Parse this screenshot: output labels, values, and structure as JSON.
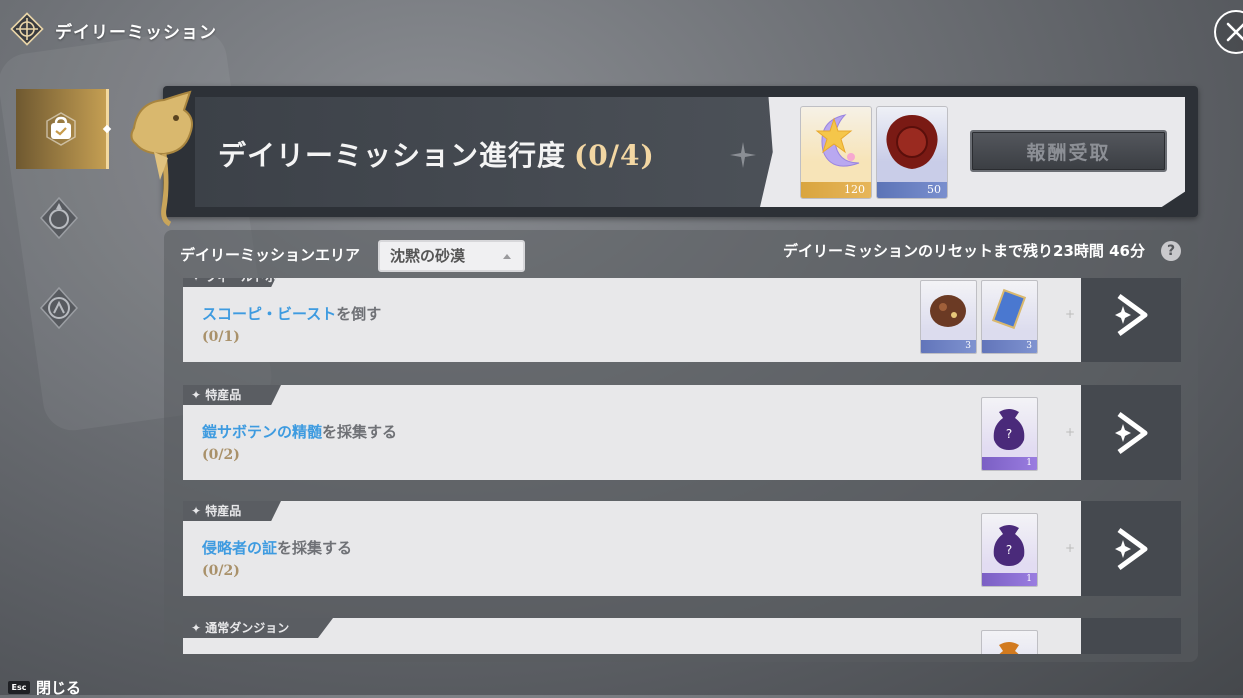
{
  "header": {
    "title": "デイリーミッション",
    "emblem_icon": "compass-emblem-icon",
    "close_icon": "close-icon"
  },
  "sidebar": {
    "items": [
      {
        "icon": "daily-mission-icon",
        "active": true
      },
      {
        "icon": "weekly-crest-icon",
        "active": false
      },
      {
        "icon": "compass-mission-icon",
        "active": false
      }
    ]
  },
  "banner": {
    "title": "デイリーミッション進行度",
    "count": "(0/4)",
    "rewards": [
      {
        "icon": "star-moon-crystal-icon",
        "qty": "120",
        "tier": "gold"
      },
      {
        "icon": "wax-seal-icon",
        "qty": "50",
        "tier": "blue"
      }
    ],
    "claim_label": "報酬受取",
    "claim_enabled": false
  },
  "filter": {
    "area_label": "デイリーミッションエリア",
    "area_value": "沈黙の砂漠",
    "reset_text": "デイリーミッションのリセットまで残り23時間 46分",
    "help_label": "?"
  },
  "missions": [
    {
      "tag": "フィールドボス",
      "title_hl": "スコーピ・ビースト",
      "title_rest": "を倒す",
      "progress": "(0/1)",
      "rewards": [
        {
          "icon": "chocolate-chest-icon",
          "qty": "3",
          "tier": "blue"
        },
        {
          "icon": "blue-card-icon",
          "qty": "3",
          "tier": "blue"
        }
      ]
    },
    {
      "tag": "特産品",
      "title_hl": "鎧サボテンの精髄",
      "title_rest": "を採集する",
      "progress": "(0/2)",
      "rewards": [
        {
          "icon": "mystery-bag-icon",
          "qty": "1",
          "tier": "purple"
        }
      ]
    },
    {
      "tag": "特産品",
      "title_hl": "侵略者の証",
      "title_rest": "を採集する",
      "progress": "(0/2)",
      "rewards": [
        {
          "icon": "mystery-bag-icon",
          "qty": "1",
          "tier": "purple"
        }
      ]
    },
    {
      "tag": "通常ダンジョン",
      "title_hl": "",
      "title_rest": "",
      "progress": "",
      "rewards": [
        {
          "icon": "orange-bag-icon",
          "qty": "",
          "tier": "orange"
        }
      ]
    }
  ],
  "footer": {
    "esc_key": "Esc",
    "esc_label": "閉じる"
  },
  "colors": {
    "accent_gold": "#f3d7a3",
    "highlight_blue": "#3e9be0",
    "progress_tan": "#a9916a"
  }
}
